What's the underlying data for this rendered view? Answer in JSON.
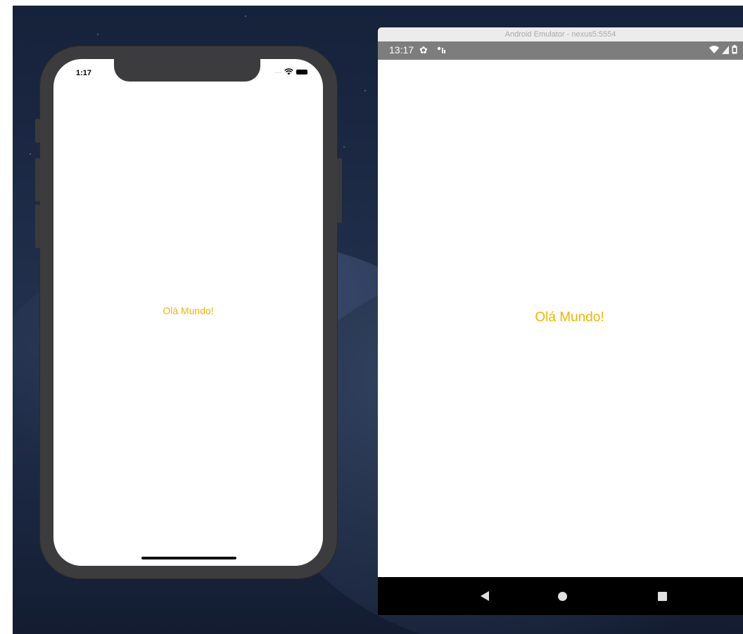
{
  "ios_simulator": {
    "status_time": "1:17",
    "signal_dots": ".....",
    "wifi_icon": "wifi-icon",
    "battery_icon": "battery-icon",
    "hello_text": "Olá Mundo!"
  },
  "android_emulator": {
    "window_title": "Android Emulator - nexus5:5554",
    "status_time": "13:17",
    "settings_icon": "gear-icon",
    "hello_text": "Olá Mundo!",
    "nav_buttons": [
      "back-icon",
      "home-icon",
      "recents-icon"
    ]
  },
  "colors": {
    "hello_text": "#f0b400",
    "android_status_bar": "#7d7d7d",
    "android_nav_bar": "#000000",
    "iphone_frame": "#3c3c3e"
  }
}
